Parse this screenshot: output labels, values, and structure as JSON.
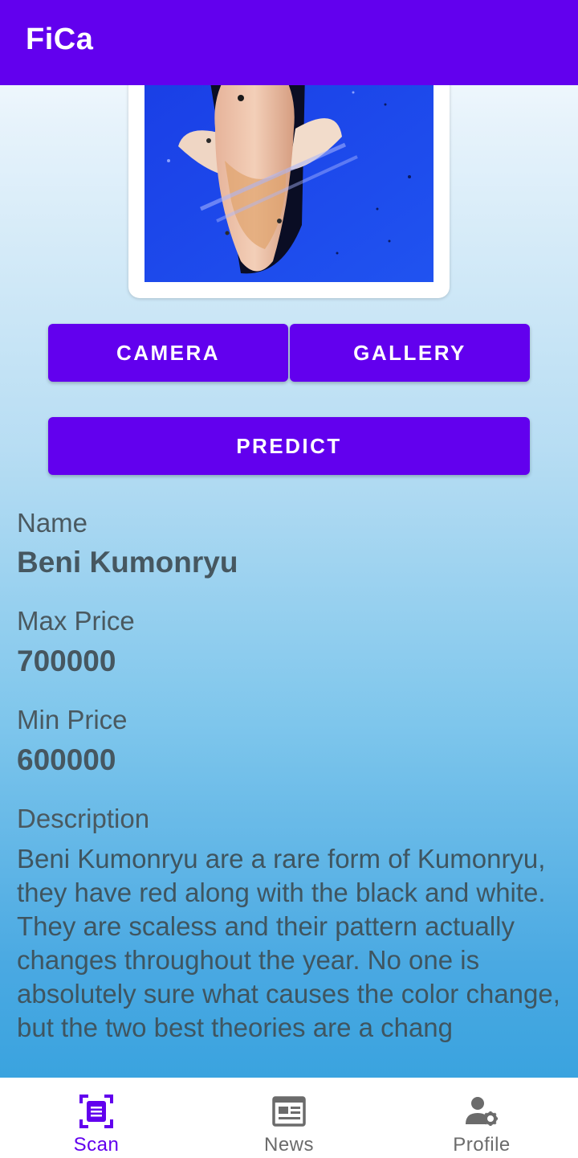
{
  "app": {
    "title": "FiCa",
    "primary_color": "#6200ee"
  },
  "image_preview": {
    "label": ""
  },
  "buttons": {
    "camera": "CAMERA",
    "gallery": "GALLERY",
    "predict": "PREDICT"
  },
  "result": {
    "name_label": "Name",
    "name_value": "Beni Kumonryu",
    "max_price_label": "Max Price",
    "max_price_value": "700000",
    "min_price_label": "Min Price",
    "min_price_value": "600000",
    "description_label": "Description",
    "description_value": "Beni Kumonryu are a rare form of Kumonryu, they have red along with the black and white. They are scaless and their pattern actually changes throughout the year. No one is absolutely sure what causes the color change, but the two best theories are a chang"
  },
  "bottom_nav": {
    "active": "scan",
    "items": [
      {
        "id": "scan",
        "label": "Scan",
        "icon": "scan-document-icon"
      },
      {
        "id": "news",
        "label": "News",
        "icon": "newspaper-icon"
      },
      {
        "id": "profile",
        "label": "Profile",
        "icon": "user-settings-icon"
      }
    ]
  }
}
